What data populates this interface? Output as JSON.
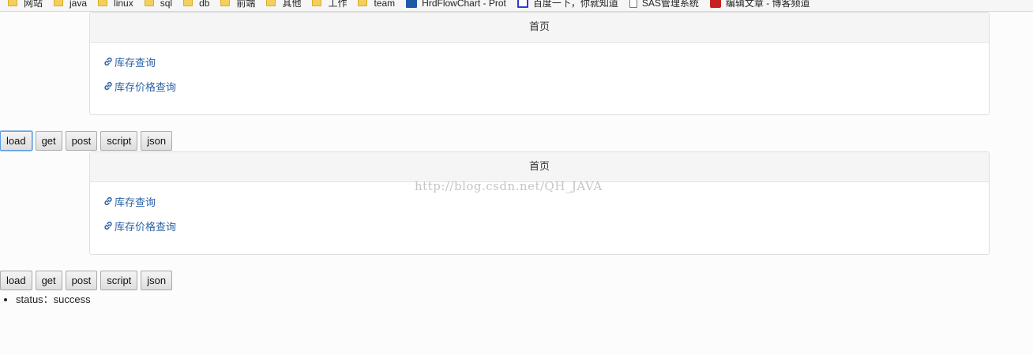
{
  "bookmarks": [
    {
      "type": "folder",
      "label": "网站"
    },
    {
      "type": "folder",
      "label": "java"
    },
    {
      "type": "folder",
      "label": "linux"
    },
    {
      "type": "folder",
      "label": "sql"
    },
    {
      "type": "folder",
      "label": "db"
    },
    {
      "type": "folder",
      "label": "前端"
    },
    {
      "type": "folder",
      "label": "其他"
    },
    {
      "type": "folder",
      "label": "工作"
    },
    {
      "type": "folder",
      "label": "team"
    },
    {
      "type": "hrd",
      "label": "HrdFlowChart - Prot"
    },
    {
      "type": "baidu",
      "label": "百度一下，你就知道"
    },
    {
      "type": "page",
      "label": "SAS管理系统"
    },
    {
      "type": "csdn",
      "label": "编辑文章 - 博客频道"
    }
  ],
  "panels": [
    {
      "header": "首页",
      "links": [
        "库存查询",
        "库存价格查询"
      ]
    },
    {
      "header": "首页",
      "links": [
        "库存查询",
        "库存价格查询"
      ]
    }
  ],
  "buttons": [
    "load",
    "get",
    "post",
    "script",
    "json"
  ],
  "result": {
    "text": "status：success"
  },
  "watermark": "http://blog.csdn.net/QH_JAVA"
}
